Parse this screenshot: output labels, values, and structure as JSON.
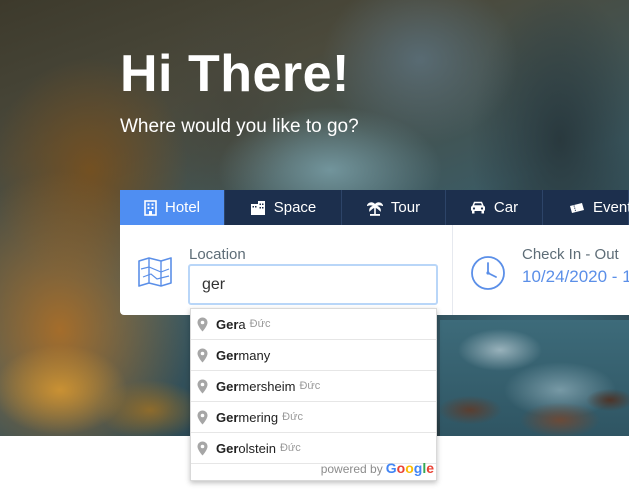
{
  "hero": {
    "title": "Hi There!",
    "subtitle": "Where would you like to go?"
  },
  "tabs": [
    {
      "label": "Hotel",
      "icon": "building-icon",
      "active": true
    },
    {
      "label": "Space",
      "icon": "office-building-icon",
      "active": false
    },
    {
      "label": "Tour",
      "icon": "palm-tree-icon",
      "active": false
    },
    {
      "label": "Car",
      "icon": "car-icon",
      "active": false
    },
    {
      "label": "Event",
      "icon": "ticket-icon",
      "active": false
    }
  ],
  "search": {
    "location_label": "Location",
    "location_value": "ger",
    "checkin_label": "Check In - Out",
    "checkin_value": "10/24/2020 - 1"
  },
  "suggestions": [
    {
      "match": "Ger",
      "rest": "a",
      "secondary": "Đức"
    },
    {
      "match": "Ger",
      "rest": "many",
      "secondary": ""
    },
    {
      "match": "Ger",
      "rest": "mersheim",
      "secondary": "Đức"
    },
    {
      "match": "Ger",
      "rest": "mering",
      "secondary": "Đức"
    },
    {
      "match": "Ger",
      "rest": "olstein",
      "secondary": "Đức"
    }
  ],
  "attribution": {
    "powered_by": "powered by",
    "google_letters": [
      "G",
      "o",
      "o",
      "g",
      "l",
      "e"
    ],
    "google_colors": [
      "#4285F4",
      "#EA4335",
      "#FBBC05",
      "#4285F4",
      "#34A853",
      "#EA4335"
    ]
  },
  "colors": {
    "accent": "#4f8ef2",
    "tab_bg": "#1c2f4d",
    "date_text": "#5b8fe8"
  }
}
